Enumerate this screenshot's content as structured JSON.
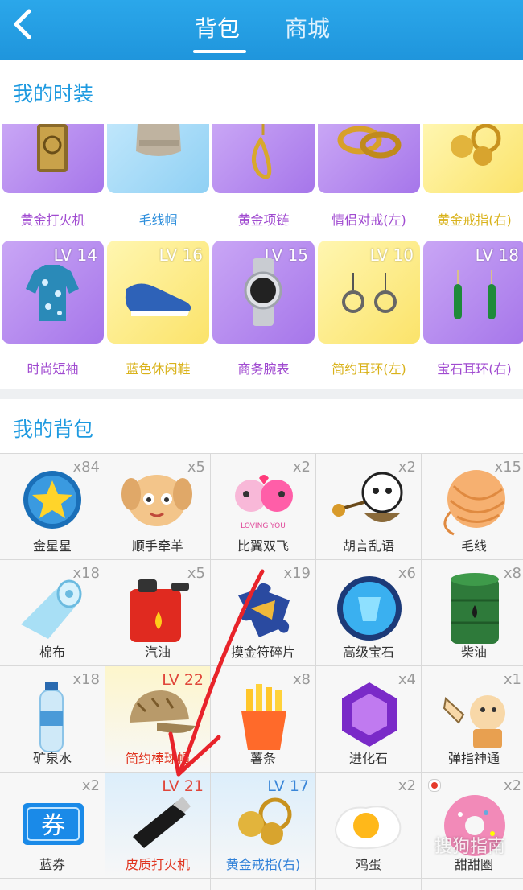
{
  "header": {
    "tabs": [
      {
        "label": "背包",
        "active": true
      },
      {
        "label": "商城",
        "active": false
      }
    ]
  },
  "fashion": {
    "title": "我的时装",
    "items": [
      {
        "name": "黄金打火机",
        "color": "purple"
      },
      {
        "name": "毛线帽",
        "color": "blue"
      },
      {
        "name": "黄金项链",
        "color": "purple"
      },
      {
        "name": "情侣对戒(左)",
        "color": "purple"
      },
      {
        "name": "黄金戒指(右)",
        "color": "yellow"
      },
      {
        "name": "时尚短袖",
        "level": "LV 14",
        "color": "purple"
      },
      {
        "name": "蓝色休闲鞋",
        "level": "LV 16",
        "color": "yellow"
      },
      {
        "name": "商务腕表",
        "level": "LV 15",
        "color": "purple"
      },
      {
        "name": "简约耳环(左)",
        "level": "LV 10",
        "color": "yellow"
      },
      {
        "name": "宝石耳环(右)",
        "level": "LV 18",
        "color": "purple"
      }
    ]
  },
  "backpack": {
    "title": "我的背包",
    "items": [
      {
        "name": "金星星",
        "count": "x84"
      },
      {
        "name": "顺手牵羊",
        "count": "x5"
      },
      {
        "name": "比翼双飞",
        "count": "x2"
      },
      {
        "name": "胡言乱语",
        "count": "x2"
      },
      {
        "name": "毛线",
        "count": "x15"
      },
      {
        "name": "棉布",
        "count": "x18"
      },
      {
        "name": "汽油",
        "count": "x5"
      },
      {
        "name": "摸金符碎片",
        "count": "x19"
      },
      {
        "name": "高级宝石",
        "count": "x6"
      },
      {
        "name": "柴油",
        "count": "x8"
      },
      {
        "name": "矿泉水",
        "count": "x18"
      },
      {
        "name": "简约棒球帽",
        "level": "LV 22"
      },
      {
        "name": "薯条",
        "count": "x8"
      },
      {
        "name": "进化石",
        "count": "x4"
      },
      {
        "name": "弹指神通",
        "count": "x1"
      },
      {
        "name": "蓝券",
        "count": "x2"
      },
      {
        "name": "皮质打火机",
        "level": "LV 21"
      },
      {
        "name": "黄金戒指(右)",
        "level": "LV 17"
      },
      {
        "name": "鸡蛋",
        "count": "x2"
      },
      {
        "name": "甜甜圈",
        "count": "x2"
      }
    ],
    "coupon_glyph": "券",
    "sticker_text": "LOVING YOU"
  },
  "watermark": "搜狗指南",
  "colors": {
    "header": "#2ba7ea",
    "section_title": "#1e9ae0",
    "annotation": "#e8232a"
  }
}
